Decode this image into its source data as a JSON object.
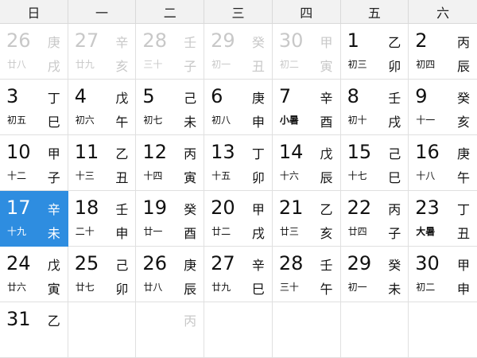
{
  "weekdays": [
    "日",
    "一",
    "二",
    "三",
    "四",
    "五",
    "六"
  ],
  "days": [
    {
      "day": "26",
      "lunar": "廿八",
      "gan": "庚",
      "zhi": "戌",
      "other": true
    },
    {
      "day": "27",
      "lunar": "廿九",
      "gan": "辛",
      "zhi": "亥",
      "other": true
    },
    {
      "day": "28",
      "lunar": "三十",
      "gan": "壬",
      "zhi": "子",
      "other": true
    },
    {
      "day": "29",
      "lunar": "初一",
      "gan": "癸",
      "zhi": "丑",
      "other": true
    },
    {
      "day": "30",
      "lunar": "初二",
      "gan": "甲",
      "zhi": "寅",
      "other": true
    },
    {
      "day": "1",
      "lunar": "初三",
      "gan": "乙",
      "zhi": "卯"
    },
    {
      "day": "2",
      "lunar": "初四",
      "gan": "丙",
      "zhi": "辰"
    },
    {
      "day": "3",
      "lunar": "初五",
      "gan": "丁",
      "zhi": "巳"
    },
    {
      "day": "4",
      "lunar": "初六",
      "gan": "戊",
      "zhi": "午"
    },
    {
      "day": "5",
      "lunar": "初七",
      "gan": "己",
      "zhi": "未"
    },
    {
      "day": "6",
      "lunar": "初八",
      "gan": "庚",
      "zhi": "申"
    },
    {
      "day": "7",
      "lunar": "小暑",
      "gan": "辛",
      "zhi": "酉",
      "term": true
    },
    {
      "day": "8",
      "lunar": "初十",
      "gan": "壬",
      "zhi": "戌"
    },
    {
      "day": "9",
      "lunar": "十一",
      "gan": "癸",
      "zhi": "亥"
    },
    {
      "day": "10",
      "lunar": "十二",
      "gan": "甲",
      "zhi": "子"
    },
    {
      "day": "11",
      "lunar": "十三",
      "gan": "乙",
      "zhi": "丑"
    },
    {
      "day": "12",
      "lunar": "十四",
      "gan": "丙",
      "zhi": "寅"
    },
    {
      "day": "13",
      "lunar": "十五",
      "gan": "丁",
      "zhi": "卯"
    },
    {
      "day": "14",
      "lunar": "十六",
      "gan": "戊",
      "zhi": "辰"
    },
    {
      "day": "15",
      "lunar": "十七",
      "gan": "己",
      "zhi": "巳"
    },
    {
      "day": "16",
      "lunar": "十八",
      "gan": "庚",
      "zhi": "午"
    },
    {
      "day": "17",
      "lunar": "十九",
      "gan": "辛",
      "zhi": "未",
      "selected": true
    },
    {
      "day": "18",
      "lunar": "二十",
      "gan": "壬",
      "zhi": "申"
    },
    {
      "day": "19",
      "lunar": "廿一",
      "gan": "癸",
      "zhi": "酉"
    },
    {
      "day": "20",
      "lunar": "廿二",
      "gan": "甲",
      "zhi": "戌"
    },
    {
      "day": "21",
      "lunar": "廿三",
      "gan": "乙",
      "zhi": "亥"
    },
    {
      "day": "22",
      "lunar": "廿四",
      "gan": "丙",
      "zhi": "子"
    },
    {
      "day": "23",
      "lunar": "大暑",
      "gan": "丁",
      "zhi": "丑",
      "term": true
    },
    {
      "day": "24",
      "lunar": "廿六",
      "gan": "戊",
      "zhi": "寅"
    },
    {
      "day": "25",
      "lunar": "廿七",
      "gan": "己",
      "zhi": "卯"
    },
    {
      "day": "26",
      "lunar": "廿八",
      "gan": "庚",
      "zhi": "辰"
    },
    {
      "day": "27",
      "lunar": "廿九",
      "gan": "辛",
      "zhi": "巳"
    },
    {
      "day": "28",
      "lunar": "三十",
      "gan": "壬",
      "zhi": "午"
    },
    {
      "day": "29",
      "lunar": "初一",
      "gan": "癸",
      "zhi": "未"
    },
    {
      "day": "30",
      "lunar": "初二",
      "gan": "甲",
      "zhi": "申"
    },
    {
      "day": "31",
      "lunar": "",
      "gan": "乙",
      "zhi": ""
    },
    {
      "day": "",
      "lunar": "",
      "gan": "",
      "zhi": "",
      "other": true
    },
    {
      "day": "",
      "lunar": "",
      "gan": "丙",
      "zhi": "",
      "other": true
    },
    {
      "day": "",
      "lunar": "",
      "gan": "",
      "zhi": "",
      "other": true
    },
    {
      "day": "",
      "lunar": "",
      "gan": "",
      "zhi": "",
      "other": true
    },
    {
      "day": "",
      "lunar": "",
      "gan": "",
      "zhi": "",
      "other": true
    },
    {
      "day": "",
      "lunar": "",
      "gan": "",
      "zhi": "",
      "other": true
    }
  ],
  "colors": {
    "selected_bg": "#2e8de0",
    "header_bg": "#f2f2f2",
    "other_month_text": "#c8c8c8"
  }
}
